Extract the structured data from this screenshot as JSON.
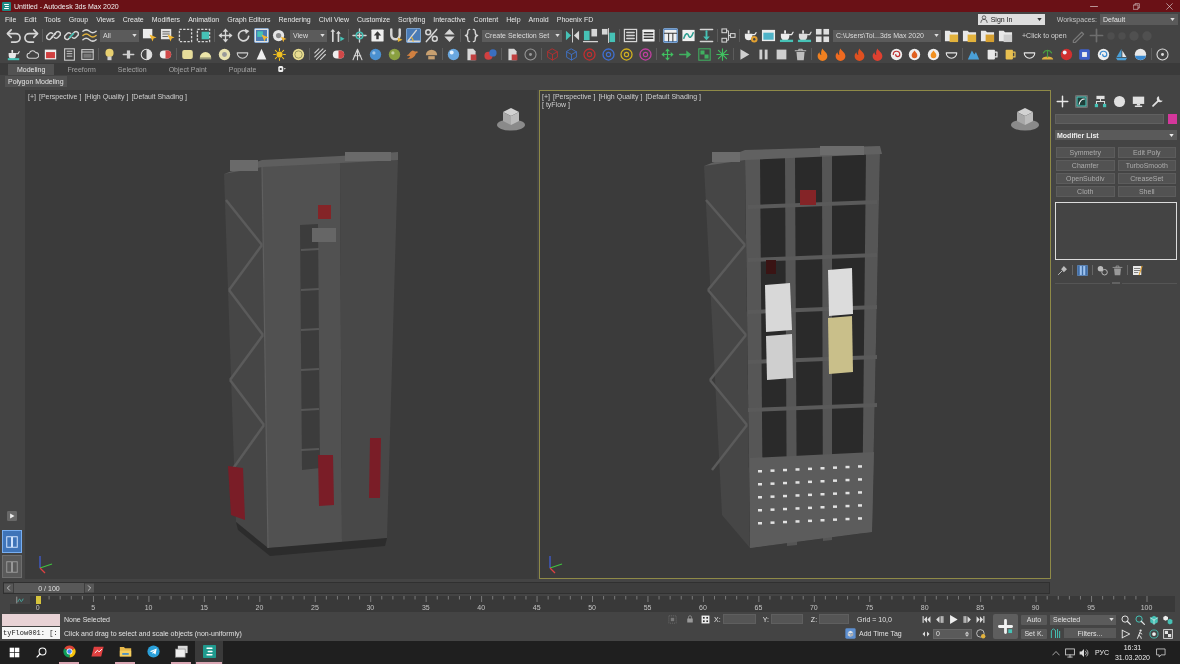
{
  "window": {
    "title": "Untitled - Autodesk 3ds Max 2020"
  },
  "menu": [
    "File",
    "Edit",
    "Tools",
    "Group",
    "Views",
    "Create",
    "Modifiers",
    "Animation",
    "Graph Editors",
    "Rendering",
    "Civil View",
    "Customize",
    "Scripting",
    "Interactive",
    "Content",
    "Help",
    "Arnold",
    "Phoenix FD"
  ],
  "account": {
    "sign_in": "Sign In",
    "workspaces_label": "Workspaces:",
    "workspace": "Default"
  },
  "main_toolbar": {
    "selection_filter": "All",
    "reference_coordinate": "View",
    "selection_set": "Create Selection Set",
    "project_path": "C:\\Users\\Tol...3ds Max 2020",
    "open_hint": "+Click to open",
    "buttons": [
      {
        "on": false
      },
      {
        "on": false
      },
      {
        "on": false
      },
      {
        "on": false
      },
      {
        "on": false
      },
      {
        "on": false
      },
      {
        "on": false
      },
      {
        "on": false
      },
      {
        "on": false
      },
      {
        "on": false
      },
      {
        "on": false
      },
      {
        "on": true
      },
      {
        "on": false
      },
      {
        "on": false
      },
      {
        "on": false
      },
      {
        "on": false
      },
      {
        "on": false
      },
      {
        "on": true
      },
      {
        "on": false
      },
      {
        "on": false
      },
      {
        "on": false
      },
      {
        "on": false
      },
      {
        "on": false
      },
      {
        "on": false
      },
      {
        "on": false
      },
      {
        "on": false
      },
      {
        "on": true
      },
      {
        "on": false
      },
      {
        "on": false
      },
      {
        "on": false
      },
      {
        "on": false
      },
      {
        "on": false
      },
      {
        "on": false
      },
      {
        "on": false
      },
      {
        "on": false
      },
      {
        "on": false
      },
      {
        "on": false
      },
      {
        "on": false
      },
      {
        "on": false
      },
      {
        "on": false
      },
      {
        "on": false
      },
      {
        "on": false
      },
      {
        "on": false
      },
      {
        "on": false
      },
      {
        "on": false
      }
    ]
  },
  "ribbon": {
    "tabs": [
      {
        "label": "Modeling",
        "selected": true
      },
      {
        "label": "Freeform",
        "selected": false
      },
      {
        "label": "Selection",
        "selected": false
      },
      {
        "label": "Object Paint",
        "selected": false
      },
      {
        "label": "Populate",
        "selected": false
      }
    ],
    "panel_button": "Polygon Modeling"
  },
  "viewport_layouts": [
    {
      "selected": true
    },
    {
      "selected": false
    }
  ],
  "viewports": [
    {
      "kind": "closed",
      "labels": [
        "[+]",
        "[Perspective ]",
        "[High Quality ]",
        "[Default Shading ]"
      ],
      "active": false
    },
    {
      "kind": "open",
      "labels": [
        "[+]",
        "[Perspective ]",
        "[High Quality ]",
        "[Default Shading ]"
      ],
      "sublabel": "[ tyFlow ]",
      "active": true
    }
  ],
  "command_panel": {
    "tabs": [
      {
        "selected": false
      },
      {
        "selected": true
      },
      {
        "selected": false
      },
      {
        "selected": false
      },
      {
        "selected": false
      },
      {
        "selected": false
      }
    ],
    "modifier_list": "Modifier List",
    "modifier_buttons": [
      {
        "label": "Symmetry",
        "disabled": true
      },
      {
        "label": "Edit Poly",
        "disabled": true
      },
      {
        "label": "Chamfer",
        "disabled": true
      },
      {
        "label": "TurboSmooth",
        "disabled": true
      },
      {
        "label": "OpenSubdiv",
        "disabled": true
      },
      {
        "label": "CreaseSet",
        "disabled": true
      },
      {
        "label": "Cloth",
        "disabled": true
      },
      {
        "label": "Shell",
        "disabled": true
      }
    ],
    "stack_tools": [
      {
        "selected": false
      },
      {
        "selected": true
      },
      {
        "selected": false
      },
      {
        "selected": false
      },
      {
        "selected": false
      }
    ]
  },
  "time_slider": {
    "label": "0 / 100",
    "level": 0
  },
  "track_bar": {
    "level": 0,
    "ticks": [
      "0",
      "5",
      "10",
      "15",
      "20",
      "25",
      "30",
      "35",
      "40",
      "45",
      "50",
      "55",
      "60",
      "65",
      "70",
      "75",
      "80",
      "85",
      "90",
      "95",
      "100"
    ]
  },
  "status": {
    "listener_input": "tyFlow001: [:",
    "selection": "None Selected",
    "prompt": "Click and drag to select and scale objects (non-uniformly)",
    "x_label": "X:",
    "y_label": "Y:",
    "z_label": "Z:",
    "grid": "Grid = 10,0",
    "time_tag": "Add Time Tag"
  },
  "animation": {
    "frame": "0",
    "auto_key": "Auto",
    "set_key": "Set K.",
    "key_filter": "Selected",
    "filters": "Filters..."
  },
  "taskbar": {
    "apps": [
      {
        "running": true,
        "active": false
      },
      {
        "running": false,
        "active": false
      },
      {
        "running": true,
        "active": false
      },
      {
        "running": false,
        "active": false
      },
      {
        "running": true,
        "active": false
      },
      {
        "running": true,
        "active": true
      }
    ],
    "language": "РУС",
    "time": "16:31",
    "date": "31.03.2020"
  }
}
